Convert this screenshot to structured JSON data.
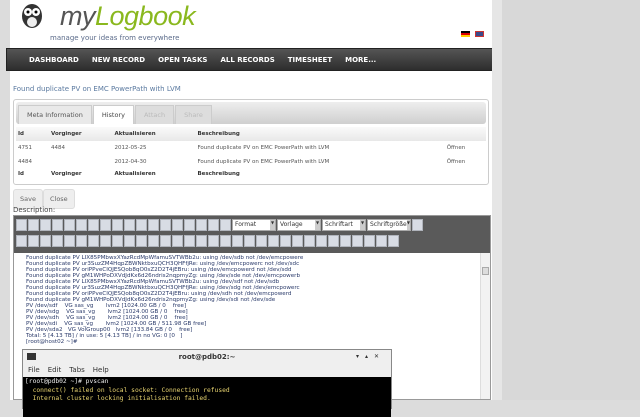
{
  "brand": {
    "my": "my",
    "logbook": "Logbook",
    "tagline": "manage your ideas from everywhere"
  },
  "nav": [
    "DASHBOARD",
    "NEW RECORD",
    "OPEN TASKS",
    "ALL RECORDS",
    "TIMESHEET",
    "MORE..."
  ],
  "record_title": "Found duplicate PV on EMC PowerPath with LVM",
  "tabs": [
    "Meta Information",
    "History",
    "Attach",
    "Share"
  ],
  "history": {
    "headers": [
      "Id",
      "Vorginger",
      "Aktualisieren",
      "Beschreibung"
    ],
    "rows": [
      [
        "4751",
        "4484",
        "2012-05-25",
        "Found duplicate PV on EMC PowerPath with LVM",
        "Öffnen"
      ],
      [
        "4484",
        "",
        "2012-04-30",
        "Found duplicate PV on EMC PowerPath with LVM",
        "Öffnen"
      ]
    ]
  },
  "buttons": {
    "save": "Save",
    "close": "Close"
  },
  "description_label": "Description:",
  "editor": {
    "format": "Format",
    "template": "Vorlage",
    "font": "Schriftart",
    "size": "Schriftgröße",
    "content": "Found duplicate PV LIX85PMbwxXYazRcdMpWfamuSVTWBb2u: using /dev/sdb not /dev/emcpowere\nFound duplicate PV ur3SuzZM4HqpZBWNktbxuQCH3QHFfjRe: using /dev/emcpowerc not /dev/sdc\nFound duplicate PV oriPPveCIQJESQob8qO0sZ2D2T4jEBru: using /dev/emcpowerd not /dev/sdd\nFound duplicate PV gM1WHPoDXVdJdKx6d26ndris2nqpmyZg: using /dev/sde not /dev/emcpowerb\nFound duplicate PV LIX85PMbwxXYazRcdMpWfamuSVTWBb2u: using /dev/sdf not /dev/sdb\nFound duplicate PV ur3SuzZM4HqpZBWNktbxuQCH3QHFfjRe: using /dev/sdg not /dev/emcpowerc\nFound duplicate PV oriPPveCIQJESQob8qO0sZ2D2T4jEBru: using /dev/sdh not /dev/emcpowerd\nFound duplicate PV gM1WHPoDXVdJdKx6d26ndris2nqpmyZg: using /dev/sdi not /dev/sde\nPV /dev/sdf    VG sas_vg       lvm2 [1024.00 GB / 0    free]\nPV /dev/sdg    VG sas_vg       lvm2 [1024.00 GB / 0    free]\nPV /dev/sdh    VG sas_vg       lvm2 [1024.00 GB / 0    free]\nPV /dev/sdi    VG sas_vg       lvm2 [1024.00 GB / 511.98 GB free]\nPV /dev/sda2   VG VolGroup00   lvm2 [133.84 GB / 0    free]\nTotal: 5 [4.13 TB] / in use: 5 [4.13 TB] / in no VG: 0 [0   ]\n[root@host02 ~]#",
    "toolbar1": [
      "bold-icon",
      "italic-icon",
      "underline-icon",
      "strike-icon",
      "align-left-icon",
      "align-center-icon",
      "align-right-icon",
      "justify-icon",
      "undo-icon",
      "redo-icon",
      "subscript-icon",
      "superscript-icon",
      "find-icon",
      "replace-icon",
      "spell-icon",
      "remove-format-icon",
      "paste-icon",
      "omega-icon"
    ],
    "toolbar2": [
      "cut-icon",
      "copy-icon",
      "paste-icon",
      "paste-text-icon",
      "paste-word-icon",
      "find-icon",
      "replace-icon",
      "bullet-list-icon",
      "number-list-icon",
      "outdent-icon",
      "indent-icon",
      "link-icon",
      "unlink-icon",
      "image-icon",
      "cleanup-icon",
      "html-icon",
      "table-icon",
      "anchor-icon",
      "text-color-icon",
      "bg-color-icon",
      "edit-icon",
      "row-icon",
      "col-icon",
      "merge-icon",
      "split-icon",
      "hr-icon",
      "eraser-icon",
      "visual-aid-icon",
      "charmap-icon",
      "fullscreen-icon",
      "style-icon",
      "spellcheck-icon"
    ]
  },
  "terminal": {
    "title": "root@pdb02:~",
    "menu": [
      "File",
      "Edit",
      "Tabs",
      "Help"
    ],
    "lines": [
      "[root@pdb02 ~]# pvscan",
      "  connect() failed on local socket: Connection refused",
      "  Internal cluster locking initialisation failed."
    ]
  }
}
